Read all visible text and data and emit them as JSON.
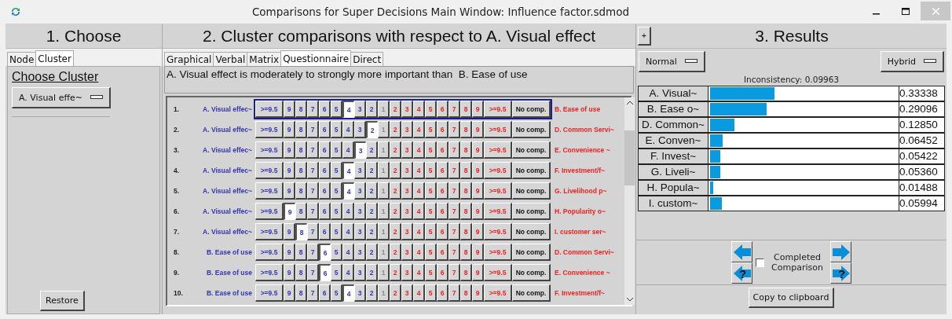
{
  "window": {
    "title": "Comparisons for Super Decisions Main Window: Influence factor.sdmod"
  },
  "choose": {
    "heading": "1. Choose",
    "tabs": [
      {
        "label": "Node",
        "selected": false
      },
      {
        "label": "Cluster",
        "selected": true
      }
    ],
    "section_title": "Choose Cluster",
    "cluster_dropdown": "A. Visual effe~",
    "restore_button": "Restore"
  },
  "comparisons": {
    "heading": "2. Cluster comparisons with respect to A. Visual effect",
    "tabs": [
      {
        "label": "Graphical",
        "selected": false
      },
      {
        "label": "Verbal",
        "selected": false
      },
      {
        "label": "Matrix",
        "selected": false
      },
      {
        "label": "Questionnaire",
        "selected": true
      },
      {
        "label": "Direct",
        "selected": false
      }
    ],
    "statement": "A. Visual effect is moderately to strongly more important than  B. Ease of use",
    "rows": [
      {
        "number": "1.",
        "left": "A. Visual effec~",
        "focused": true,
        "right": "B. Ease of use",
        "buttons": [
          {
            "label": ">=9.5",
            "selected": false
          },
          {
            "label": "9",
            "selected": false
          },
          {
            "label": "8",
            "selected": false
          },
          {
            "label": "7",
            "selected": false
          },
          {
            "label": "6",
            "selected": false
          },
          {
            "label": "5",
            "selected": false
          },
          {
            "label": "4",
            "selected": true
          },
          {
            "label": "3",
            "selected": false
          },
          {
            "label": "2",
            "selected": false
          },
          {
            "label": "1",
            "selected": false
          },
          {
            "label": "2",
            "selected": false
          },
          {
            "label": "3",
            "selected": false
          },
          {
            "label": "4",
            "selected": false
          },
          {
            "label": "5",
            "selected": false
          },
          {
            "label": "6",
            "selected": false
          },
          {
            "label": "7",
            "selected": false
          },
          {
            "label": "8",
            "selected": false
          },
          {
            "label": "9",
            "selected": false
          },
          {
            "label": ">=9.5",
            "selected": false
          },
          {
            "label": "No comp.",
            "selected": false
          }
        ]
      },
      {
        "number": "2.",
        "left": "A. Visual effec~",
        "focused": false,
        "right": "D. Common Servi~",
        "buttons": [
          {
            "label": ">=9.5",
            "selected": false
          },
          {
            "label": "9",
            "selected": false
          },
          {
            "label": "8",
            "selected": false
          },
          {
            "label": "7",
            "selected": false
          },
          {
            "label": "6",
            "selected": false
          },
          {
            "label": "5",
            "selected": false
          },
          {
            "label": "4",
            "selected": false
          },
          {
            "label": "3",
            "selected": false
          },
          {
            "label": "2",
            "selected": true
          },
          {
            "label": "1",
            "selected": false
          },
          {
            "label": "2",
            "selected": false
          },
          {
            "label": "3",
            "selected": false
          },
          {
            "label": "4",
            "selected": false
          },
          {
            "label": "5",
            "selected": false
          },
          {
            "label": "6",
            "selected": false
          },
          {
            "label": "7",
            "selected": false
          },
          {
            "label": "8",
            "selected": false
          },
          {
            "label": "9",
            "selected": false
          },
          {
            "label": ">=9.5",
            "selected": false
          },
          {
            "label": "No comp.",
            "selected": false
          }
        ]
      },
      {
        "number": "3.",
        "left": "A. Visual effec~",
        "focused": false,
        "right": "E. Convenience ~",
        "buttons": [
          {
            "label": ">=9.5",
            "selected": false
          },
          {
            "label": "9",
            "selected": false
          },
          {
            "label": "8",
            "selected": false
          },
          {
            "label": "7",
            "selected": false
          },
          {
            "label": "6",
            "selected": false
          },
          {
            "label": "5",
            "selected": false
          },
          {
            "label": "4",
            "selected": false
          },
          {
            "label": "3",
            "selected": true
          },
          {
            "label": "2",
            "selected": false
          },
          {
            "label": "1",
            "selected": false
          },
          {
            "label": "2",
            "selected": false
          },
          {
            "label": "3",
            "selected": false
          },
          {
            "label": "4",
            "selected": false
          },
          {
            "label": "5",
            "selected": false
          },
          {
            "label": "6",
            "selected": false
          },
          {
            "label": "7",
            "selected": false
          },
          {
            "label": "8",
            "selected": false
          },
          {
            "label": "9",
            "selected": false
          },
          {
            "label": ">=9.5",
            "selected": false
          },
          {
            "label": "No comp.",
            "selected": false
          }
        ]
      },
      {
        "number": "4.",
        "left": "A. Visual effec~",
        "focused": false,
        "right": "F. Investment/f~",
        "buttons": [
          {
            "label": ">=9.5",
            "selected": false
          },
          {
            "label": "9",
            "selected": false
          },
          {
            "label": "8",
            "selected": false
          },
          {
            "label": "7",
            "selected": false
          },
          {
            "label": "6",
            "selected": false
          },
          {
            "label": "5",
            "selected": false
          },
          {
            "label": "4",
            "selected": true
          },
          {
            "label": "3",
            "selected": false
          },
          {
            "label": "2",
            "selected": false
          },
          {
            "label": "1",
            "selected": false
          },
          {
            "label": "2",
            "selected": false
          },
          {
            "label": "3",
            "selected": false
          },
          {
            "label": "4",
            "selected": false
          },
          {
            "label": "5",
            "selected": false
          },
          {
            "label": "6",
            "selected": false
          },
          {
            "label": "7",
            "selected": false
          },
          {
            "label": "8",
            "selected": false
          },
          {
            "label": "9",
            "selected": false
          },
          {
            "label": ">=9.5",
            "selected": false
          },
          {
            "label": "No comp.",
            "selected": false
          }
        ]
      },
      {
        "number": "5.",
        "left": "A. Visual effec~",
        "focused": false,
        "right": "G. Livelihood p~",
        "buttons": [
          {
            "label": ">=9.5",
            "selected": false
          },
          {
            "label": "9",
            "selected": false
          },
          {
            "label": "8",
            "selected": false
          },
          {
            "label": "7",
            "selected": false
          },
          {
            "label": "6",
            "selected": false
          },
          {
            "label": "5",
            "selected": false
          },
          {
            "label": "4",
            "selected": true
          },
          {
            "label": "3",
            "selected": false
          },
          {
            "label": "2",
            "selected": false
          },
          {
            "label": "1",
            "selected": false
          },
          {
            "label": "2",
            "selected": false
          },
          {
            "label": "3",
            "selected": false
          },
          {
            "label": "4",
            "selected": false
          },
          {
            "label": "5",
            "selected": false
          },
          {
            "label": "6",
            "selected": false
          },
          {
            "label": "7",
            "selected": false
          },
          {
            "label": "8",
            "selected": false
          },
          {
            "label": "9",
            "selected": false
          },
          {
            "label": ">=9.5",
            "selected": false
          },
          {
            "label": "No comp.",
            "selected": false
          }
        ]
      },
      {
        "number": "6.",
        "left": "A. Visual effec~",
        "focused": false,
        "right": "H. Popularity o~",
        "buttons": [
          {
            "label": ">=9.5",
            "selected": false
          },
          {
            "label": "9",
            "selected": true
          },
          {
            "label": "8",
            "selected": false
          },
          {
            "label": "7",
            "selected": false
          },
          {
            "label": "6",
            "selected": false
          },
          {
            "label": "5",
            "selected": false
          },
          {
            "label": "4",
            "selected": false
          },
          {
            "label": "3",
            "selected": false
          },
          {
            "label": "2",
            "selected": false
          },
          {
            "label": "1",
            "selected": false
          },
          {
            "label": "2",
            "selected": false
          },
          {
            "label": "3",
            "selected": false
          },
          {
            "label": "4",
            "selected": false
          },
          {
            "label": "5",
            "selected": false
          },
          {
            "label": "6",
            "selected": false
          },
          {
            "label": "7",
            "selected": false
          },
          {
            "label": "8",
            "selected": false
          },
          {
            "label": "9",
            "selected": false
          },
          {
            "label": ">=9.5",
            "selected": false
          },
          {
            "label": "No comp.",
            "selected": false
          }
        ]
      },
      {
        "number": "7.",
        "left": "A. Visual effec~",
        "focused": false,
        "right": "I. customer ser~",
        "buttons": [
          {
            "label": ">=9.5",
            "selected": false
          },
          {
            "label": "9",
            "selected": false
          },
          {
            "label": "8",
            "selected": true
          },
          {
            "label": "7",
            "selected": false
          },
          {
            "label": "6",
            "selected": false
          },
          {
            "label": "5",
            "selected": false
          },
          {
            "label": "4",
            "selected": false
          },
          {
            "label": "3",
            "selected": false
          },
          {
            "label": "2",
            "selected": false
          },
          {
            "label": "1",
            "selected": false
          },
          {
            "label": "2",
            "selected": false
          },
          {
            "label": "3",
            "selected": false
          },
          {
            "label": "4",
            "selected": false
          },
          {
            "label": "5",
            "selected": false
          },
          {
            "label": "6",
            "selected": false
          },
          {
            "label": "7",
            "selected": false
          },
          {
            "label": "8",
            "selected": false
          },
          {
            "label": "9",
            "selected": false
          },
          {
            "label": ">=9.5",
            "selected": false
          },
          {
            "label": "No comp.",
            "selected": false
          }
        ]
      },
      {
        "number": "8.",
        "left": "B. Ease of use",
        "focused": false,
        "right": "D. Common Servi~",
        "buttons": [
          {
            "label": ">=9.5",
            "selected": false
          },
          {
            "label": "9",
            "selected": false
          },
          {
            "label": "8",
            "selected": false
          },
          {
            "label": "7",
            "selected": false
          },
          {
            "label": "6",
            "selected": true
          },
          {
            "label": "5",
            "selected": false
          },
          {
            "label": "4",
            "selected": false
          },
          {
            "label": "3",
            "selected": false
          },
          {
            "label": "2",
            "selected": false
          },
          {
            "label": "1",
            "selected": false
          },
          {
            "label": "2",
            "selected": false
          },
          {
            "label": "3",
            "selected": false
          },
          {
            "label": "4",
            "selected": false
          },
          {
            "label": "5",
            "selected": false
          },
          {
            "label": "6",
            "selected": false
          },
          {
            "label": "7",
            "selected": false
          },
          {
            "label": "8",
            "selected": false
          },
          {
            "label": "9",
            "selected": false
          },
          {
            "label": ">=9.5",
            "selected": false
          },
          {
            "label": "No comp.",
            "selected": false
          }
        ]
      },
      {
        "number": "9.",
        "left": "B. Ease of use",
        "focused": false,
        "right": "E. Convenience ~",
        "buttons": [
          {
            "label": ">=9.5",
            "selected": false
          },
          {
            "label": "9",
            "selected": false
          },
          {
            "label": "8",
            "selected": false
          },
          {
            "label": "7",
            "selected": false
          },
          {
            "label": "6",
            "selected": true
          },
          {
            "label": "5",
            "selected": false
          },
          {
            "label": "4",
            "selected": false
          },
          {
            "label": "3",
            "selected": false
          },
          {
            "label": "2",
            "selected": false
          },
          {
            "label": "1",
            "selected": false
          },
          {
            "label": "2",
            "selected": false
          },
          {
            "label": "3",
            "selected": false
          },
          {
            "label": "4",
            "selected": false
          },
          {
            "label": "5",
            "selected": false
          },
          {
            "label": "6",
            "selected": false
          },
          {
            "label": "7",
            "selected": false
          },
          {
            "label": "8",
            "selected": false
          },
          {
            "label": "9",
            "selected": false
          },
          {
            "label": ">=9.5",
            "selected": false
          },
          {
            "label": "No comp.",
            "selected": false
          }
        ]
      },
      {
        "number": "10.",
        "left": "B. Ease of use",
        "focused": false,
        "right": "F. Investment/f~",
        "buttons": [
          {
            "label": ">=9.5",
            "selected": false
          },
          {
            "label": "9",
            "selected": false
          },
          {
            "label": "8",
            "selected": false
          },
          {
            "label": "7",
            "selected": false
          },
          {
            "label": "6",
            "selected": false
          },
          {
            "label": "5",
            "selected": false
          },
          {
            "label": "4",
            "selected": true
          },
          {
            "label": "3",
            "selected": false
          },
          {
            "label": "2",
            "selected": false
          },
          {
            "label": "1",
            "selected": false
          },
          {
            "label": "2",
            "selected": false
          },
          {
            "label": "3",
            "selected": false
          },
          {
            "label": "4",
            "selected": false
          },
          {
            "label": "5",
            "selected": false
          },
          {
            "label": "6",
            "selected": false
          },
          {
            "label": "7",
            "selected": false
          },
          {
            "label": "8",
            "selected": false
          },
          {
            "label": "9",
            "selected": false
          },
          {
            "label": ">=9.5",
            "selected": false
          },
          {
            "label": "No comp.",
            "selected": false
          }
        ]
      }
    ]
  },
  "results": {
    "expand_button": "+",
    "heading": "3. Results",
    "mode_dropdown": "Normal",
    "method_dropdown": "Hybrid",
    "inconsistency": "Inconsistency: 0.09963",
    "priorities": [
      {
        "name": "A. Visual~",
        "level": 0.333,
        "value": "0.33338"
      },
      {
        "name": "B. Ease o~",
        "level": 0.291,
        "value": "0.29096"
      },
      {
        "name": "D. Common~",
        "level": 0.128,
        "value": "0.12850"
      },
      {
        "name": "E. Conven~",
        "level": 0.065,
        "value": "0.06452"
      },
      {
        "name": "F. Invest~",
        "level": 0.054,
        "value": "0.05422"
      },
      {
        "name": "G. Liveli~",
        "level": 0.054,
        "value": "0.05360"
      },
      {
        "name": "H. Popula~",
        "level": 0.015,
        "value": "0.01488"
      },
      {
        "name": "I. custom~",
        "level": 0.06,
        "value": "0.05994"
      }
    ],
    "help_mark_left": "?",
    "help_mark_right": "?",
    "completed": {
      "label": "Completed Comparison",
      "checked": false
    },
    "copy_button": "Copy to clipboard"
  }
}
